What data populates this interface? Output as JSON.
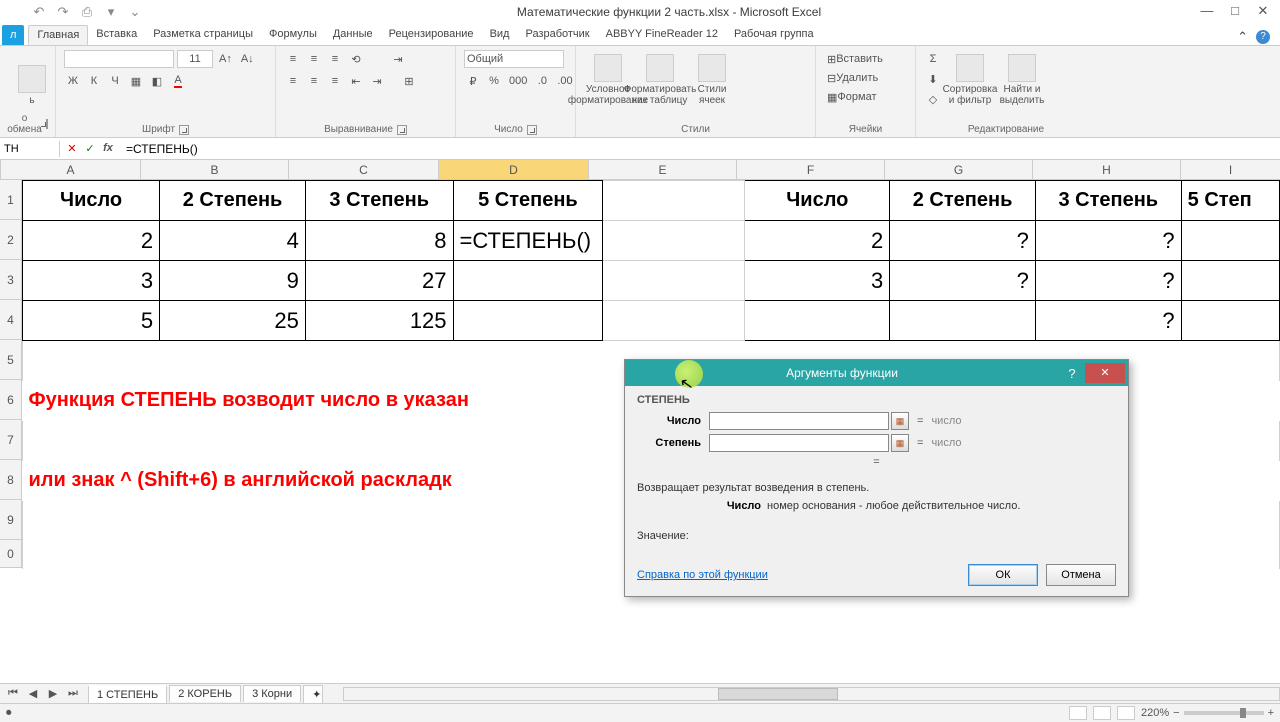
{
  "title": "Математические функции 2 часть.xlsx - Microsoft Excel",
  "qat": [
    "↶",
    "↷",
    "⎙",
    "▾",
    "⌄"
  ],
  "winbtns": [
    "—",
    "□",
    "✕"
  ],
  "tabs": {
    "file": "л",
    "items": [
      "Главная",
      "Вставка",
      "Разметка страницы",
      "Формулы",
      "Данные",
      "Рецензирование",
      "Вид",
      "Разработчик",
      "ABBYY FineReader 12",
      "Рабочая группа"
    ],
    "active": 0
  },
  "ribbon": {
    "clipboard": {
      "label": "о обмена",
      "paste": "ь"
    },
    "font": {
      "label": "Шрифт",
      "family": "",
      "size": "11",
      "buttons": [
        "Ж",
        "К",
        "Ч"
      ]
    },
    "align": {
      "label": "Выравнивание"
    },
    "number": {
      "label": "Число",
      "format": "Общий"
    },
    "styles": {
      "label": "Стили",
      "cond": "Условное\nформатирование",
      "table": "Форматировать\nкак таблицу",
      "cell": "Стили\nячеек"
    },
    "cells": {
      "label": "Ячейки",
      "ins": "Вставить",
      "del": "Удалить",
      "fmt": "Формат"
    },
    "edit": {
      "label": "Редактирование",
      "sum": "Σ",
      "sort": "Сортировка\nи фильтр",
      "find": "Найти и\nвыделить"
    }
  },
  "namebox": "ТН",
  "formula": "=СТЕПЕНЬ()",
  "cols": {
    "widths": [
      140,
      148,
      150,
      150,
      148,
      148,
      148,
      148,
      148,
      100
    ],
    "letters": [
      "A",
      "B",
      "C",
      "D",
      "E",
      "F",
      "G",
      "H",
      "I"
    ],
    "active": "D"
  },
  "rows": [
    "1",
    "2",
    "3",
    "4",
    "5",
    "6",
    "7",
    "8",
    "9",
    "0"
  ],
  "grid": {
    "h1": [
      "Число",
      "2 Степень",
      "3 Степень",
      "5 Степень",
      "",
      "Число",
      "2 Степень",
      "3 Степень",
      "5 Степ"
    ],
    "r2": [
      "2",
      "4",
      "8",
      "=СТЕПЕНЬ()",
      "",
      "2",
      "?",
      "?",
      ""
    ],
    "r3": [
      "3",
      "9",
      "27",
      "",
      "",
      "3",
      "?",
      "?",
      ""
    ],
    "r4": [
      "5",
      "25",
      "125",
      "",
      "",
      "",
      "",
      "?",
      ""
    ],
    "text1": "Функция СТЕПЕНЬ возводит число в указан",
    "text2": "или знак ^ (Shift+6) в английской раскладк"
  },
  "dialog": {
    "title": "Аргументы функции",
    "fname": "СТЕПЕНЬ",
    "arg1": {
      "label": "Число",
      "hint": "число"
    },
    "arg2": {
      "label": "Степень",
      "hint": "число"
    },
    "desc": "Возвращает результат возведения в степень.",
    "argdesc_label": "Число",
    "argdesc_text": "номер основания - любое действительное число.",
    "value": "Значение:",
    "help": "Справка по этой функции",
    "ok": "ОК",
    "cancel": "Отмена"
  },
  "sheets": {
    "tabs": [
      "1 СТЕПЕНЬ",
      "2 КОРЕНЬ",
      "3 Корни"
    ],
    "active": 0
  },
  "status": {
    "zoom": "220%"
  }
}
